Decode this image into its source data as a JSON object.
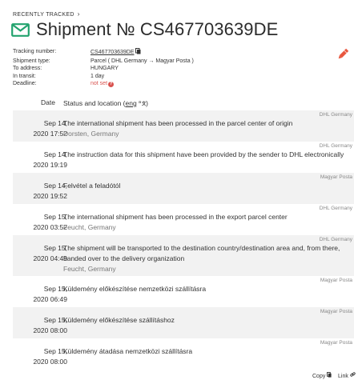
{
  "breadcrumb": {
    "label": "RECENTLY TRACKED",
    "chevron": "›"
  },
  "header": {
    "title": "Shipment № CS467703639DE",
    "icon": "envelope-icon",
    "accent": "#23a36e"
  },
  "info": [
    {
      "key": "Tracking number:",
      "value": "CS467703639DE"
    },
    {
      "key": "Shipment type:",
      "value": "Parcel ( DHL Germany → Magyar Posta )"
    },
    {
      "key": "To address:",
      "value": "HUNGARY"
    },
    {
      "key": "In transit:",
      "value": "1 day"
    },
    {
      "key": "Deadline:",
      "value": "not set"
    }
  ],
  "table_header": {
    "date": "Date",
    "status": "Status and location (",
    "lang": "eng",
    "close": ")"
  },
  "events": [
    {
      "date": "Sep 14,",
      "time": "2020 17:52",
      "carrier": "DHL Germany",
      "text": "The international shipment has been processed in the parcel center of origin",
      "location": "Dorsten, Germany"
    },
    {
      "date": "Sep 14,",
      "time": "2020 19:19",
      "carrier": "DHL Germany",
      "text": "The instruction data for this shipment have been provided by the sender to DHL electronically",
      "location": ""
    },
    {
      "date": "Sep 14,",
      "time": "2020 19:52",
      "carrier": "Magyar Posta",
      "text": "Felvétel a feladótól",
      "location": ""
    },
    {
      "date": "Sep 15,",
      "time": "2020 03:52",
      "carrier": "DHL Germany",
      "text": "The international shipment has been processed in the export parcel center",
      "location": "Feucht, Germany"
    },
    {
      "date": "Sep 15,",
      "time": "2020 04:49",
      "carrier": "DHL Germany",
      "text": "The shipment will be transported to the destination country/destination area and, from there, handed over to the delivery organization",
      "location": "Feucht, Germany"
    },
    {
      "date": "Sep 15,",
      "time": "2020 06:49",
      "carrier": "Magyar Posta",
      "text": "Küldemény előkészítése nemzetközi szállításra",
      "location": ""
    },
    {
      "date": "Sep 15,",
      "time": "2020 08:00",
      "carrier": "Magyar Posta",
      "text": "Küldemény előkészítése szállításhoz",
      "location": ""
    },
    {
      "date": "Sep 15,",
      "time": "2020 08:00",
      "carrier": "Magyar Posta",
      "text": "Küldemény átadása nemzetközi szállításra",
      "location": ""
    }
  ],
  "footer": {
    "copy": "Copy",
    "link": "Link"
  }
}
